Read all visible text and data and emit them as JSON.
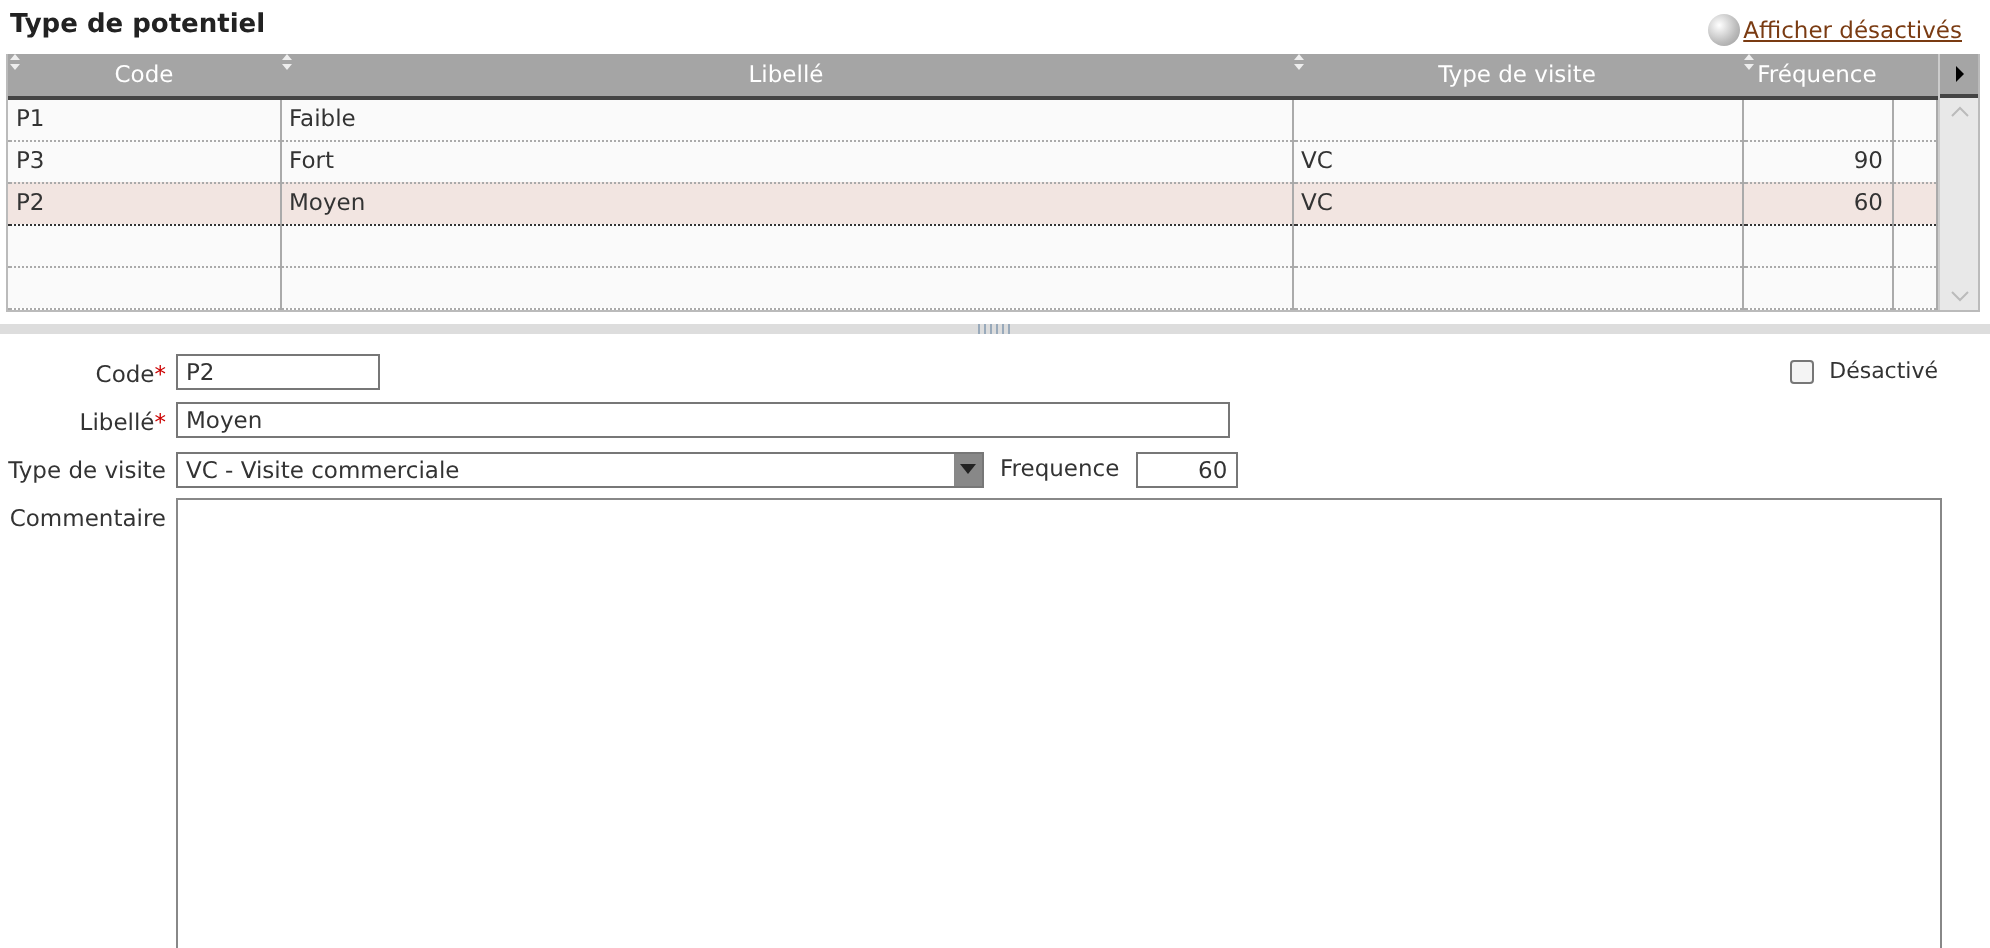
{
  "title": "Type de potentiel",
  "show_disabled_link": "Afficher désactivés",
  "table": {
    "columns": [
      "Code",
      "Libellé",
      "Type de visite",
      "Fréquence"
    ],
    "rows": [
      {
        "code": "P1",
        "libelle": "Faible",
        "type_visite": "",
        "frequence": "",
        "selected": false
      },
      {
        "code": "P3",
        "libelle": "Fort",
        "type_visite": "VC",
        "frequence": "90",
        "selected": false
      },
      {
        "code": "P2",
        "libelle": "Moyen",
        "type_visite": "VC",
        "frequence": "60",
        "selected": true
      }
    ]
  },
  "form": {
    "code": {
      "label": "Code",
      "required_mark": "*",
      "value": "P2"
    },
    "libelle": {
      "label": "Libellé",
      "required_mark": "*",
      "value": "Moyen"
    },
    "type_visite": {
      "label": "Type de visite",
      "value": "VC - Visite commerciale"
    },
    "frequence": {
      "label": "Frequence",
      "value": "60"
    },
    "commentaire": {
      "label": "Commentaire"
    },
    "desactive": {
      "label": "Désactivé",
      "checked": false
    }
  }
}
